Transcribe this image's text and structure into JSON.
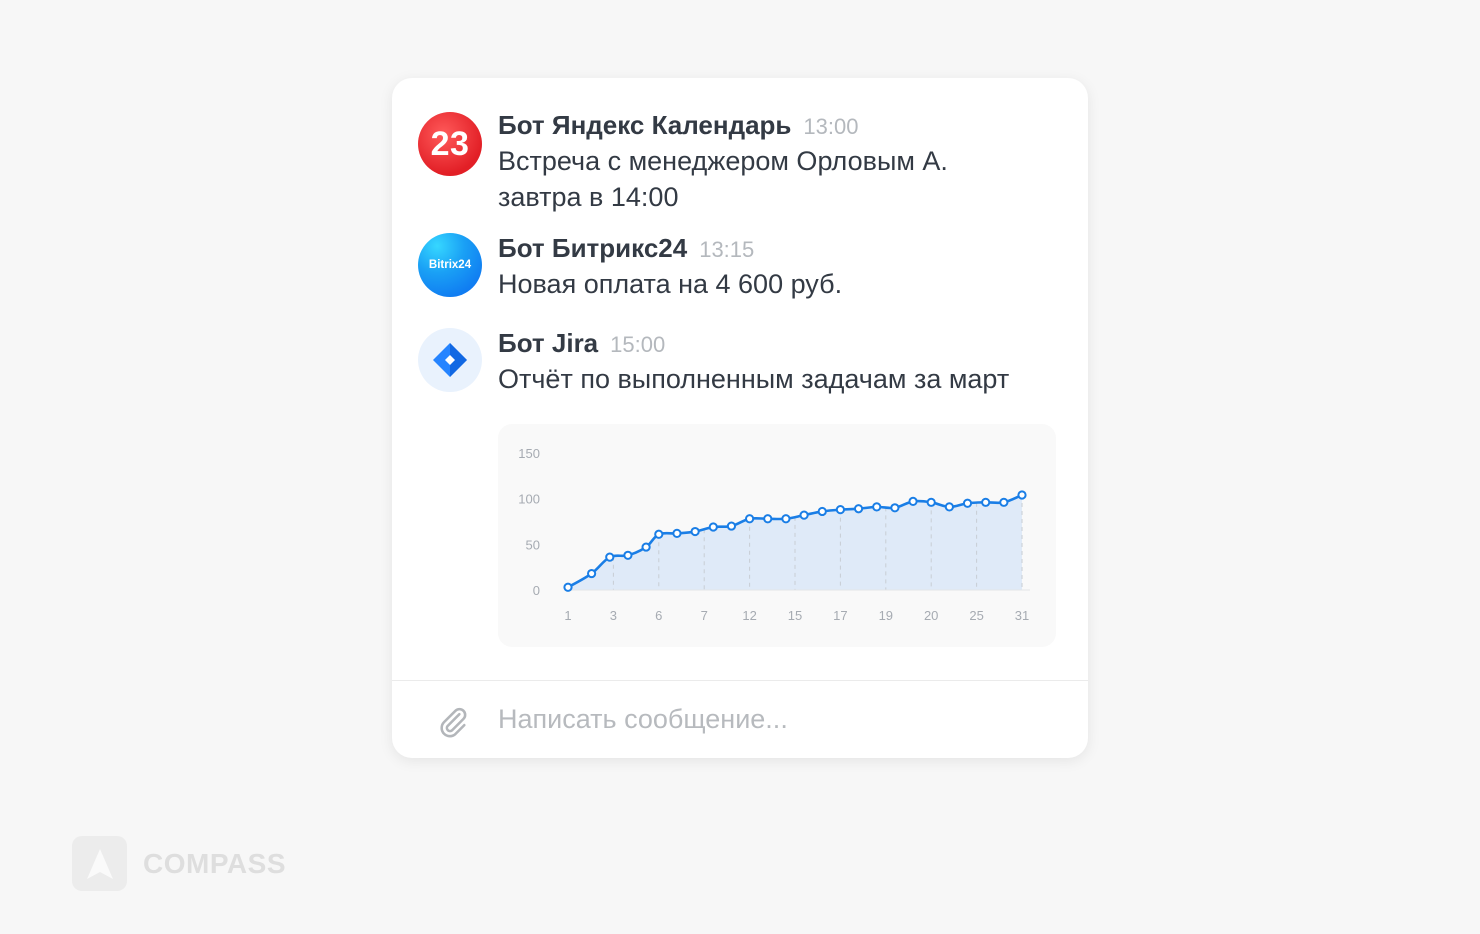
{
  "messages": [
    {
      "avatar_text": "23",
      "avatar_icon": "calendar-date-icon",
      "author": "Бот Яндекс Календарь",
      "time": "13:00",
      "text": "Встреча с менеджером Орловым А. завтра в 14:00"
    },
    {
      "avatar_text": "Bitrix24",
      "avatar_icon": "bitrix24-logo-icon",
      "author": "Бот Битрикс24",
      "time": "13:15",
      "text": "Новая оплата на 4 600 руб."
    },
    {
      "avatar_icon": "jira-logo-icon",
      "author": "Бот Jira",
      "time": "15:00",
      "text": "Отчёт по выполненным задачам за март"
    }
  ],
  "composer": {
    "placeholder": "Написать сообщение...",
    "attach_icon": "paperclip-icon"
  },
  "brand": {
    "name": "COMPASS",
    "logo_icon": "compass-logo-icon"
  },
  "colors": {
    "accent": "#1a7ee6",
    "calendar_red": "#e21f26",
    "bitrix_blue": "#1aa0f5",
    "jira_blue": "#2684ff"
  },
  "chart_data": {
    "type": "line",
    "title": "",
    "xlabel": "",
    "ylabel": "",
    "ylim": [
      0,
      150
    ],
    "yticks": [
      0,
      50,
      100,
      150
    ],
    "grid": false,
    "area_fill": true,
    "x_tick_labels": [
      "1",
      "3",
      "6",
      "7",
      "12",
      "15",
      "17",
      "19",
      "20",
      "25",
      "31"
    ],
    "x_tick_positions": [
      0,
      2.5,
      5,
      7.5,
      10,
      12.5,
      15,
      17.5,
      20,
      22.5,
      25
    ],
    "series": [
      {
        "x": [
          0,
          1.3,
          2.3,
          3.3,
          4.3,
          5,
          6,
          7,
          8,
          9,
          10,
          11,
          12,
          13,
          14,
          15,
          16,
          17,
          18,
          19,
          20,
          21,
          22,
          23,
          24,
          25
        ],
        "values": [
          3,
          18,
          36,
          38,
          47,
          61,
          62,
          64,
          69,
          70,
          78,
          78,
          78,
          82,
          86,
          88,
          89,
          91,
          90,
          97,
          96,
          91,
          95,
          96,
          96,
          104
        ]
      }
    ]
  }
}
